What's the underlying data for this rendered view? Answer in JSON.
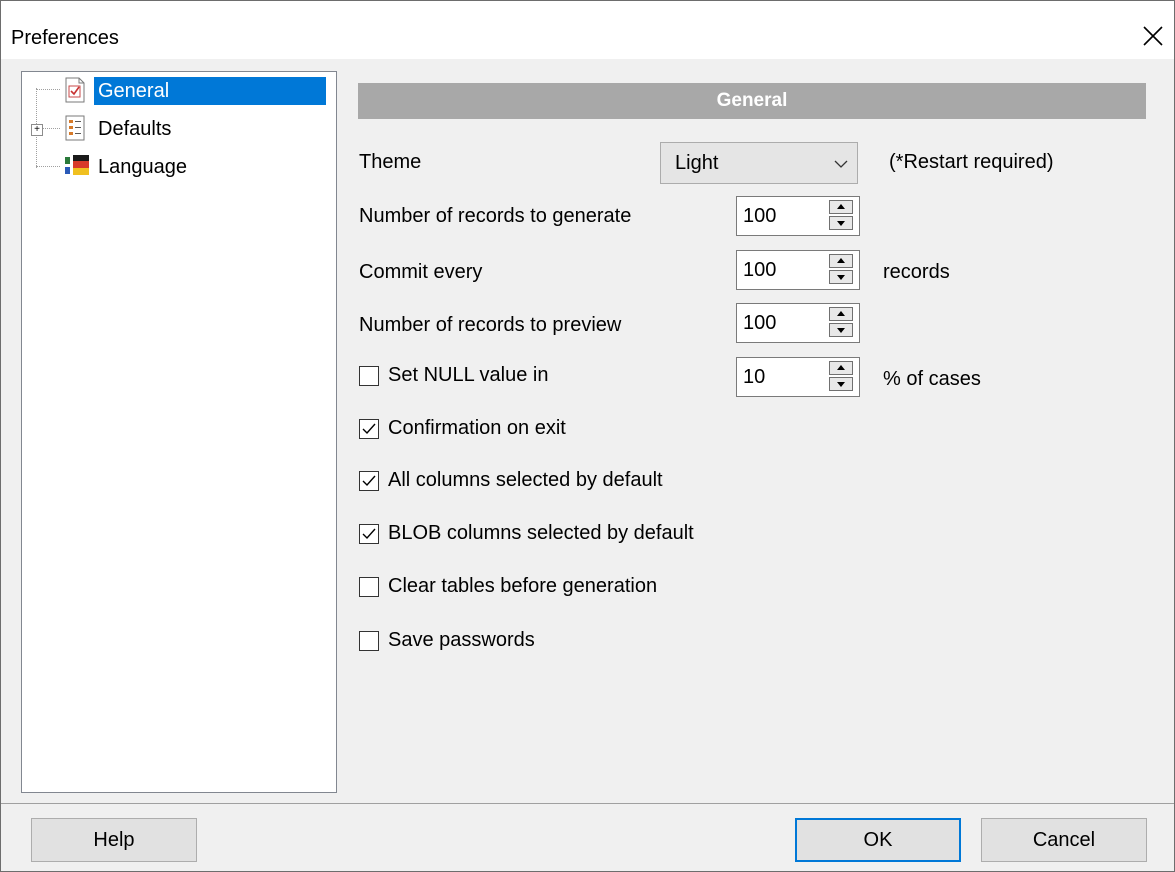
{
  "window": {
    "title": "Preferences"
  },
  "tree": {
    "items": [
      {
        "label": "General",
        "selected": true,
        "icon": "checklist-page-icon"
      },
      {
        "label": "Defaults",
        "selected": false,
        "icon": "list-page-icon",
        "expandable": true
      },
      {
        "label": "Language",
        "selected": false,
        "icon": "flag-icon"
      }
    ]
  },
  "section": {
    "header": "General"
  },
  "theme": {
    "label": "Theme",
    "value": "Light",
    "note": "(*Restart required)"
  },
  "records_generate": {
    "label": "Number of records to generate",
    "value": "100"
  },
  "commit": {
    "label": "Commit every",
    "value": "100",
    "suffix": "records"
  },
  "records_preview": {
    "label": "Number of records to preview",
    "value": "100"
  },
  "null_value": {
    "label": "Set NULL value in",
    "value": "10",
    "suffix": "% of cases",
    "checked": false
  },
  "options": [
    {
      "label": "Confirmation on exit",
      "checked": true
    },
    {
      "label": "All columns selected by default",
      "checked": true
    },
    {
      "label": "BLOB columns selected by default",
      "checked": true
    },
    {
      "label": "Clear tables before generation",
      "checked": false
    },
    {
      "label": "Save passwords",
      "checked": false
    }
  ],
  "buttons": {
    "help": "Help",
    "ok": "OK",
    "cancel": "Cancel"
  },
  "colors": {
    "selection": "#0078d7",
    "header_bg": "#a8a8a8",
    "default_button_border": "#0078d7"
  }
}
